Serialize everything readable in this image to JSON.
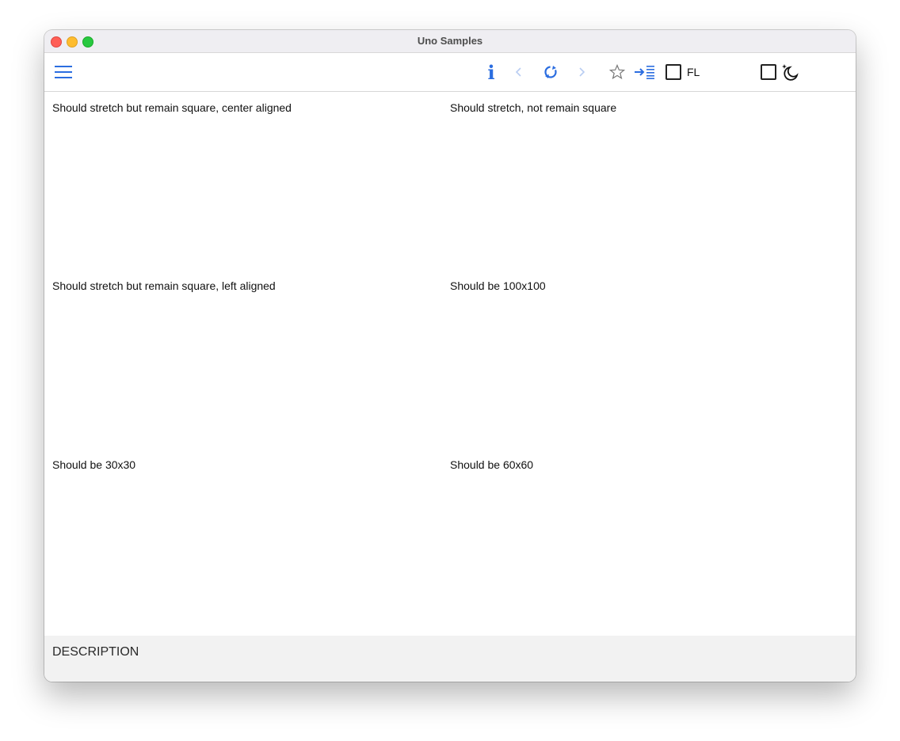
{
  "window": {
    "title": "Uno Samples"
  },
  "toolbar": {
    "info_glyph": "i",
    "fl_label": "FL",
    "accent_color": "#2b6de0"
  },
  "samples": [
    {
      "label": "Should stretch but remain square, center aligned"
    },
    {
      "label": "Should stretch, not remain square"
    },
    {
      "label": "Should stretch but remain square, left aligned"
    },
    {
      "label": "Should be 100x100"
    },
    {
      "label": "Should be 30x30"
    },
    {
      "label": "Should be 60x60"
    }
  ],
  "description": {
    "label": "DESCRIPTION"
  }
}
